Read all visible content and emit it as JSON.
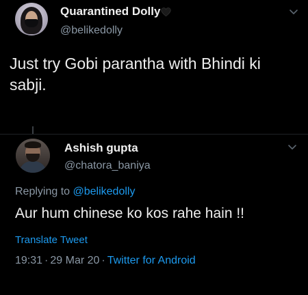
{
  "original_tweet": {
    "display_name": "Quarantined Dolly",
    "name_emoji_icon": "black-heart-icon",
    "handle": "@belikedolly",
    "text": "Just try Gobi parantha with Bhindi ki sabji."
  },
  "reply_tweet": {
    "display_name": "Ashish gupta",
    "handle": "@chatora_baniya",
    "replying_to_prefix": "Replying to",
    "replying_to_handle": "@belikedolly",
    "text": "Aur hum chinese ko kos rahe hain !!",
    "translate_label": "Translate Tweet",
    "time": "19:31",
    "separator": "·",
    "date": "29 Mar 20",
    "source": "Twitter for Android"
  },
  "colors": {
    "background": "#000000",
    "primary_text": "#eeeeee",
    "secondary_text": "#8b98a5",
    "accent": "#1d9bf0"
  }
}
